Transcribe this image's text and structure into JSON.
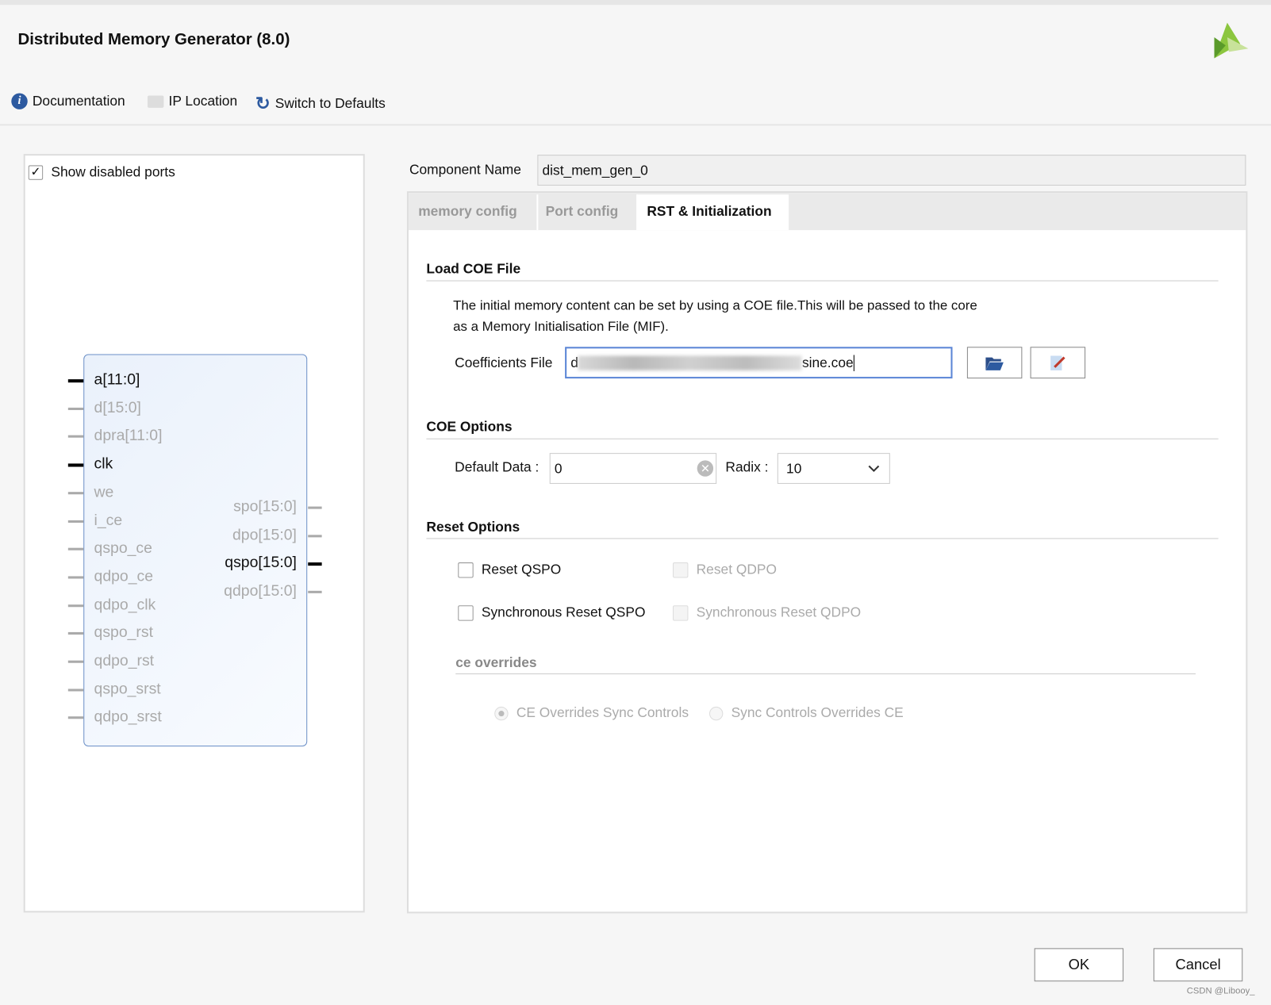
{
  "window": {
    "title": "Distributed Memory Generator (8.0)"
  },
  "toolbar": {
    "documentation": "Documentation",
    "ip_location": "IP Location",
    "switch_defaults": "Switch to Defaults"
  },
  "symbol": {
    "show_disabled_ports_label": "Show disabled ports",
    "show_disabled_ports_checked": true,
    "inputs": [
      {
        "name": "a[11:0]",
        "active": true
      },
      {
        "name": "d[15:0]",
        "active": false
      },
      {
        "name": "dpra[11:0]",
        "active": false
      },
      {
        "name": "clk",
        "active": true
      },
      {
        "name": "we",
        "active": false
      },
      {
        "name": "i_ce",
        "active": false
      },
      {
        "name": "qspo_ce",
        "active": false
      },
      {
        "name": "qdpo_ce",
        "active": false
      },
      {
        "name": "qdpo_clk",
        "active": false
      },
      {
        "name": "qspo_rst",
        "active": false
      },
      {
        "name": "qdpo_rst",
        "active": false
      },
      {
        "name": "qspo_srst",
        "active": false
      },
      {
        "name": "qdpo_srst",
        "active": false
      }
    ],
    "outputs": [
      {
        "name": "spo[15:0]",
        "active": false
      },
      {
        "name": "dpo[15:0]",
        "active": false
      },
      {
        "name": "qspo[15:0]",
        "active": true
      },
      {
        "name": "qdpo[15:0]",
        "active": false
      }
    ]
  },
  "component": {
    "label": "Component Name",
    "value": "dist_mem_gen_0"
  },
  "tabs": [
    {
      "label": "memory config",
      "active": false
    },
    {
      "label": "Port config",
      "active": false
    },
    {
      "label": "RST & Initialization",
      "active": true
    }
  ],
  "coe": {
    "title": "Load COE File",
    "desc1": "The initial memory content can be set by using a COE file.This will be passed to the core",
    "desc2": "as a Memory Initialisation File (MIF).",
    "file_label": "Coefficients File",
    "file_prefix": "d",
    "file_suffix": "sine.coe"
  },
  "coe_options": {
    "title": "COE Options",
    "default_label": "Default Data :",
    "default_value": "0",
    "radix_label": "Radix :",
    "radix_value": "10"
  },
  "reset": {
    "title": "Reset Options",
    "reset_qspo": "Reset QSPO",
    "reset_qdpo": "Reset QDPO",
    "sync_qspo": "Synchronous Reset QSPO",
    "sync_qdpo": "Synchronous Reset QDPO"
  },
  "ce": {
    "title": "ce overrides",
    "opt1": "CE Overrides Sync Controls",
    "opt2": "Sync Controls Overrides CE",
    "selected": "CE Overrides Sync Controls"
  },
  "footer": {
    "ok": "OK",
    "cancel": "Cancel",
    "watermark": "CSDN @Libooy_"
  },
  "colors": {
    "accent": "#2d5aa0",
    "logo": "#8cc63f"
  }
}
